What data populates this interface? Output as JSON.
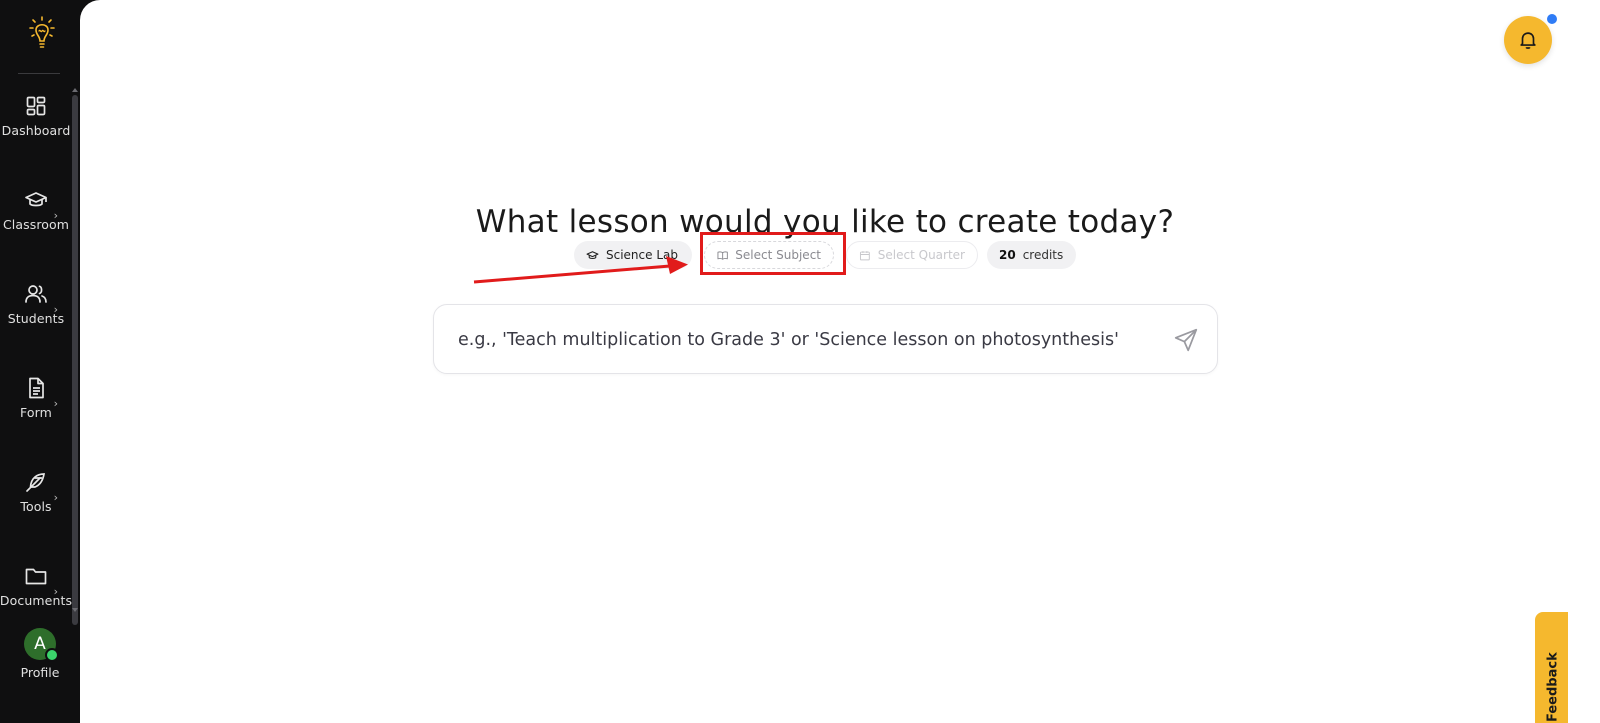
{
  "sidebar": {
    "items": [
      {
        "label": "Dashboard",
        "icon": "dashboard-grid-icon",
        "has_submenu": false
      },
      {
        "label": "Classroom",
        "icon": "graduation-cap-icon",
        "has_submenu": true
      },
      {
        "label": "Students",
        "icon": "users-icon",
        "has_submenu": true
      },
      {
        "label": "Form",
        "icon": "document-icon",
        "has_submenu": true
      },
      {
        "label": "Tools",
        "icon": "feather-icon",
        "has_submenu": true
      },
      {
        "label": "Documents",
        "icon": "folder-icon",
        "has_submenu": true
      }
    ],
    "profile": {
      "initial": "A",
      "label": "Profile",
      "online": true
    }
  },
  "main": {
    "headline": "What lesson would you like to create today?",
    "pills": {
      "classroom": "Science Lab",
      "subject": "Select Subject",
      "quarter": "Select Quarter",
      "credits_count": "20",
      "credits_label": "credits"
    },
    "prompt": {
      "placeholder": "e.g., 'Teach multiplication to Grade 3' or 'Science lesson on photosynthesis'"
    }
  },
  "notifications": {
    "has_unread": true
  },
  "feedback": {
    "label": "Feedback"
  },
  "annotations": {
    "highlight_color": "#e11b1b",
    "highlighted": "Select Subject"
  },
  "colors": {
    "accent": "#f5b82e",
    "sidebar_bg": "#0f0f10",
    "notification_dot": "#2f7cf6",
    "online_status": "#3bd36b"
  }
}
